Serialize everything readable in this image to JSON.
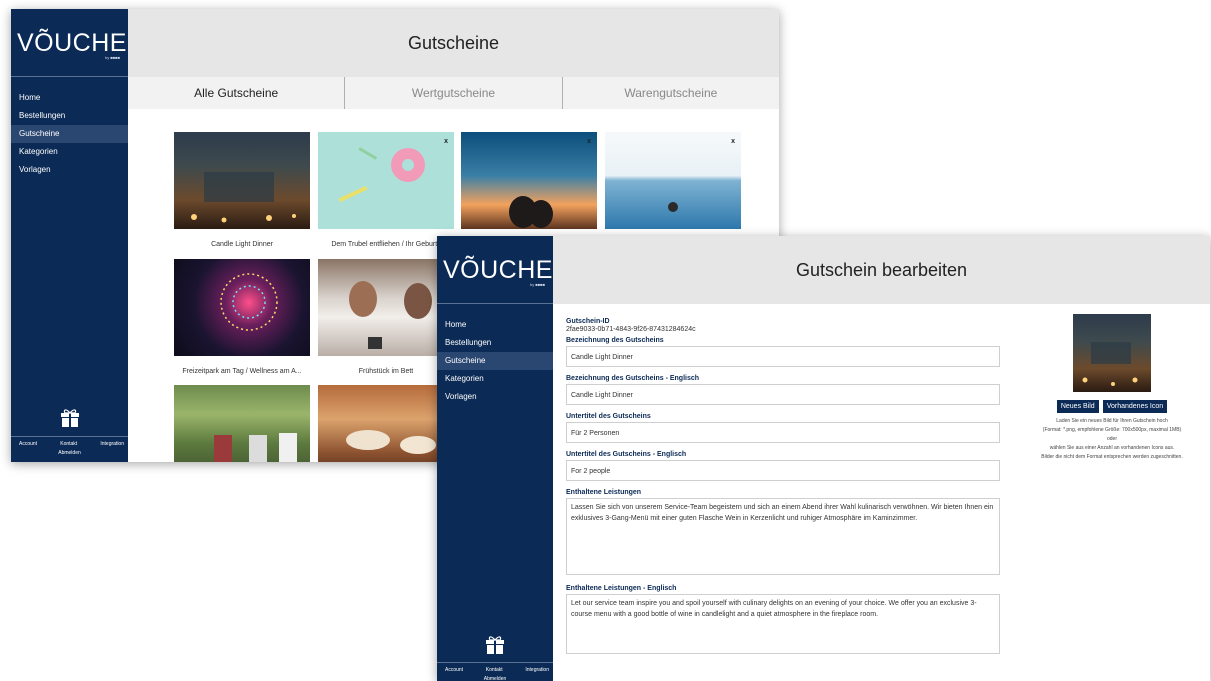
{
  "brand": {
    "logo": "VÕUCHER",
    "sub": "by ■■■■"
  },
  "nav": [
    "Home",
    "Bestellungen",
    "Gutscheine",
    "Kategorien",
    "Vorlagen"
  ],
  "footer": {
    "account": "Account",
    "contact": "Kontakt",
    "integration": "Integration",
    "logout": "Abmelden"
  },
  "list_window": {
    "title": "Gutscheine",
    "tabs": [
      "Alle Gutscheine",
      "Wertgutscheine",
      "Warengutscheine"
    ],
    "cards": [
      {
        "title": "Candle Light Dinner",
        "close": ""
      },
      {
        "title": "Dem Trubel entfliehen / Ihr Geburts",
        "close": "x"
      },
      {
        "title": "",
        "close": "x"
      },
      {
        "title": "",
        "close": "x"
      },
      {
        "title": "Freizeitpark am Tag / Wellness am A...",
        "close": ""
      },
      {
        "title": "Frühstück im Bett",
        "close": ""
      },
      {
        "title": "",
        "close": ""
      },
      {
        "title": "",
        "close": ""
      }
    ]
  },
  "edit_window": {
    "title": "Gutschein bearbeiten",
    "fields": {
      "id_label": "Gutschein-ID",
      "id_value": "2fae9033-0b71-4843-9f26-87431284624c",
      "name_label": "Bezeichnung des Gutscheins",
      "name_value": "Candle Light Dinner",
      "name_en_label": "Bezeichnung des Gutscheins - Englisch",
      "name_en_value": "Candle Light Dinner",
      "subtitle_label": "Untertitel des Gutscheins",
      "subtitle_value": "Für 2 Personen",
      "subtitle_en_label": "Untertitel des Gutscheins - Englisch",
      "subtitle_en_value": "For 2 people",
      "services_label": "Enthaltene Leistungen",
      "services_value": "Lassen Sie sich von unserem Service-Team begeistern und sich an einem Abend ihrer Wahl kulinarisch verwöhnen. Wir bieten Ihnen ein exklusives 3-Gang-Menü mit einer guten Flasche Wein in Kerzenlicht und ruhiger Atmosphäre im Kaminzimmer.",
      "services_en_label": "Enthaltene Leistungen - Englisch",
      "services_en_value": "Let our service team inspire you and spoil yourself with culinary delights on an evening of your choice. We offer you an exclusive 3-course menu with a good bottle of wine in candlelight and a quiet atmosphere in the fireplace room."
    },
    "image_panel": {
      "new_image": "Neues Bild",
      "existing_icon": "Vorhandenes Icon",
      "hint1": "Laden Sie ein neues Bild für Ihren Gutschein hoch",
      "hint2": "(Format: *.png, empfohlene Größe: 700x500px, maximal 1MB)",
      "hint3": "oder",
      "hint4": "wählen Sie aus einer Anzahl an vorhandenen Icons aus.",
      "hint5": "Bilder die nicht dem Format entsprechen werden zugeschnitten."
    }
  }
}
